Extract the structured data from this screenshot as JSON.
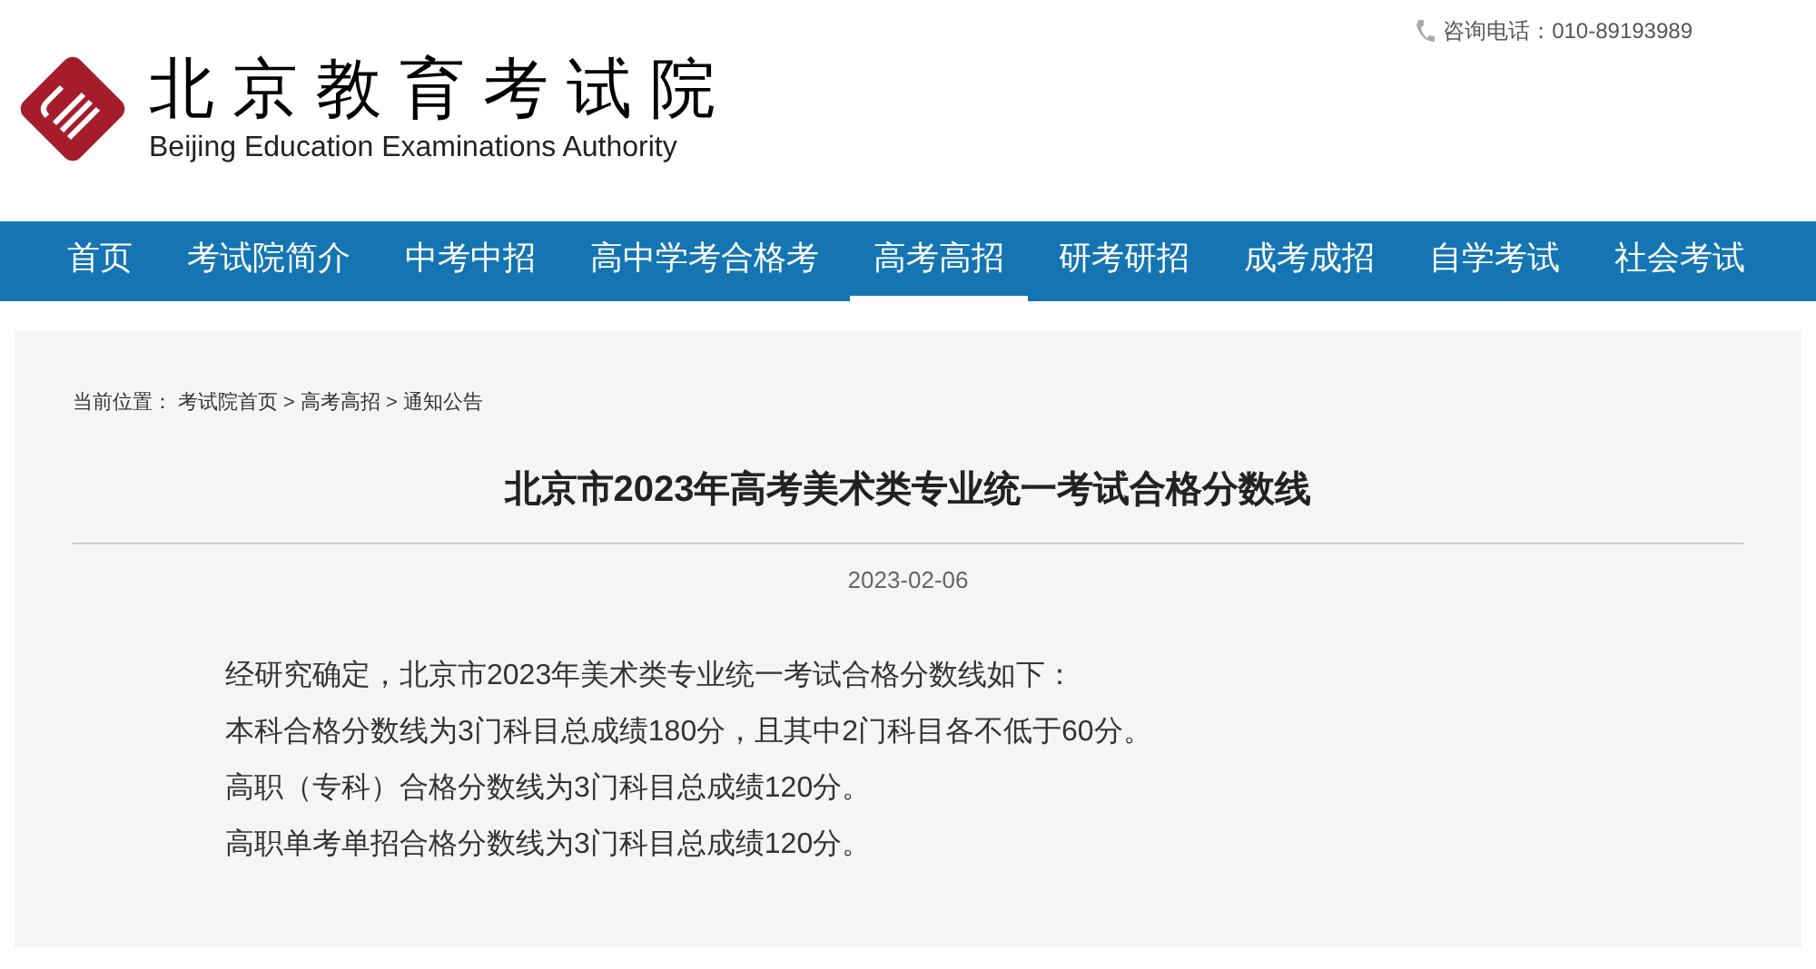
{
  "header": {
    "logo_title": "北京教育考试院",
    "logo_subtitle": "Beijing Education Examinations Authority",
    "hotline": "咨询电话：010-89193989"
  },
  "nav": [
    {
      "label": "首页",
      "selected": false
    },
    {
      "label": "考试院简介",
      "selected": false
    },
    {
      "label": "中考中招",
      "selected": false
    },
    {
      "label": "高中学考合格考",
      "selected": false
    },
    {
      "label": "高考高招",
      "selected": true
    },
    {
      "label": "研考研招",
      "selected": false
    },
    {
      "label": "成考成招",
      "selected": false
    },
    {
      "label": "自学考试",
      "selected": false
    },
    {
      "label": "社会考试",
      "selected": false
    }
  ],
  "breadcrumb": {
    "label": "当前位置：",
    "items": [
      "考试院首页",
      "高考高招",
      "通知公告"
    ],
    "separators": [
      ">",
      ">"
    ]
  },
  "article": {
    "title": "北京市2023年高考美术类专业统一考试合格分数线",
    "date": "2023-02-06",
    "paragraphs": [
      "经研究确定，北京市2023年美术类专业统一考试合格分数线如下：",
      "本科合格分数线为3门科目总成绩180分，且其中2门科目各不低于60分。",
      "高职（专科）合格分数线为3门科目总成绩120分。",
      "高职单考单招合格分数线为3门科目总成绩120分。"
    ]
  }
}
